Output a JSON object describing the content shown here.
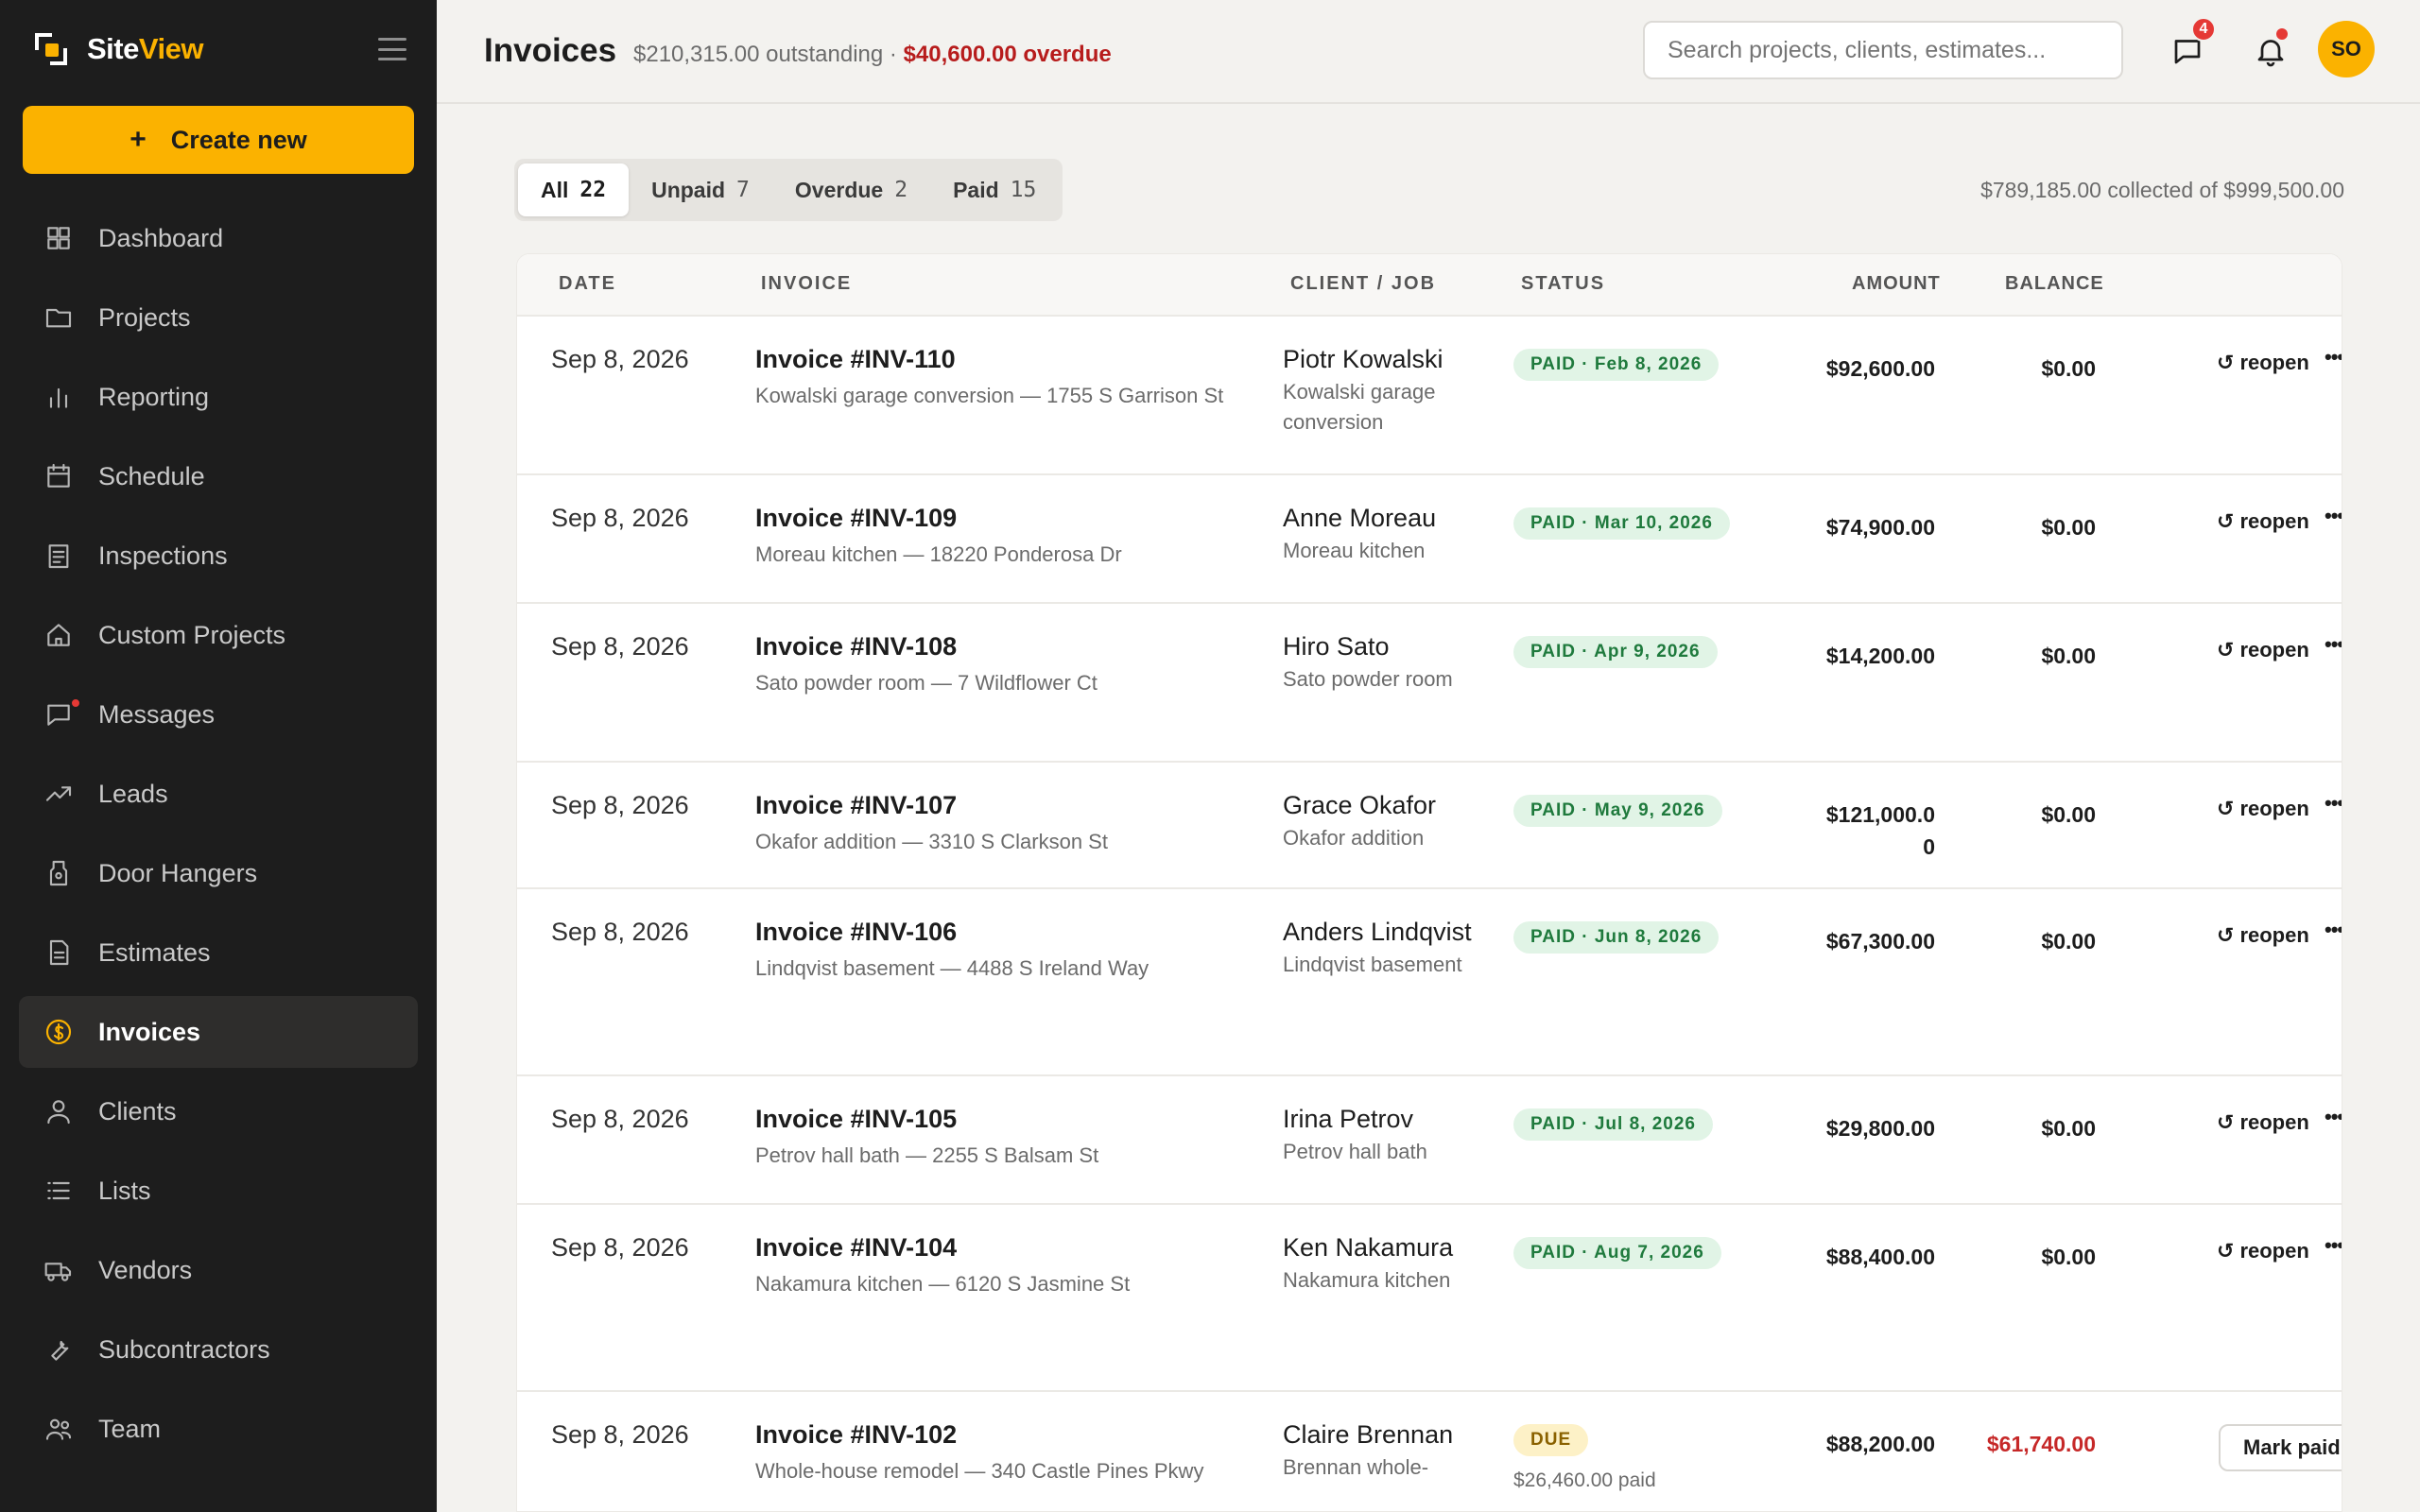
{
  "brand": {
    "name_part1": "Site",
    "name_part2": "View"
  },
  "create_button": {
    "plus": "+",
    "label": "Create new"
  },
  "nav": [
    {
      "label": "Dashboard",
      "icon": "dashboard-icon",
      "active": false
    },
    {
      "label": "Projects",
      "icon": "folder-icon",
      "active": false
    },
    {
      "label": "Reporting",
      "icon": "bar-chart-icon",
      "active": false
    },
    {
      "label": "Schedule",
      "icon": "calendar-icon",
      "active": false
    },
    {
      "label": "Inspections",
      "icon": "clipboard-icon",
      "active": false
    },
    {
      "label": "Custom Projects",
      "icon": "home-icon",
      "active": false
    },
    {
      "label": "Messages",
      "icon": "message-icon",
      "active": false
    },
    {
      "label": "Leads",
      "icon": "trending-up-icon",
      "active": false
    },
    {
      "label": "Door Hangers",
      "icon": "tag-icon",
      "active": false
    },
    {
      "label": "Estimates",
      "icon": "document-icon",
      "active": false
    },
    {
      "label": "Invoices",
      "icon": "dollar-icon",
      "active": true
    },
    {
      "label": "Clients",
      "icon": "user-icon",
      "active": false
    },
    {
      "label": "Lists",
      "icon": "list-icon",
      "active": false
    },
    {
      "label": "Vendors",
      "icon": "truck-icon",
      "active": false
    },
    {
      "label": "Subcontractors",
      "icon": "wrench-icon",
      "active": false
    },
    {
      "label": "Team",
      "icon": "team-icon",
      "active": false
    }
  ],
  "header": {
    "title": "Invoices",
    "outstanding": "$210,315.00 outstanding · ",
    "overdue": "$40,600.00 overdue",
    "search_placeholder": "Search projects, clients, estimates...",
    "messages_badge": "4",
    "avatar_initials": "SO"
  },
  "tabs": [
    {
      "label": "All",
      "count": "22",
      "active": true
    },
    {
      "label": "Unpaid",
      "count": "7",
      "active": false
    },
    {
      "label": "Overdue",
      "count": "2",
      "active": false
    },
    {
      "label": "Paid",
      "count": "15",
      "active": false
    }
  ],
  "collected": "$789,185.00 collected of $999,500.00",
  "table": {
    "columns": {
      "date": "DATE",
      "invoice": "INVOICE",
      "client": "CLIENT / JOB",
      "status": "STATUS",
      "amount": "AMOUNT",
      "balance": "BALANCE"
    },
    "rows": [
      {
        "date": "Sep 8, 2026",
        "title": "Invoice #INV-110",
        "sub": "Kowalski garage conversion — 1755 S Garrison St",
        "client": "Piotr Kowalski",
        "job": "Kowalski garage conversion",
        "status": "PAID · Feb 8, 2026",
        "status_type": "paid",
        "paid_note": "",
        "amount": "$92,600.00",
        "balance": "$0.00",
        "action": "reopen"
      },
      {
        "date": "Sep 8, 2026",
        "title": "Invoice #INV-109",
        "sub": "Moreau kitchen — 18220 Ponderosa Dr",
        "client": "Anne Moreau",
        "job": "Moreau kitchen",
        "status": "PAID · Mar 10, 2026",
        "status_type": "paid",
        "paid_note": "",
        "amount": "$74,900.00",
        "balance": "$0.00",
        "action": "reopen"
      },
      {
        "date": "Sep 8, 2026",
        "title": "Invoice #INV-108",
        "sub": "Sato powder room — 7 Wildflower Ct",
        "client": "Hiro Sato",
        "job": "Sato powder room",
        "status": "PAID · Apr 9, 2026",
        "status_type": "paid",
        "paid_note": "",
        "amount": "$14,200.00",
        "balance": "$0.00",
        "action": "reopen"
      },
      {
        "date": "Sep 8, 2026",
        "title": "Invoice #INV-107",
        "sub": "Okafor addition — 3310 S Clarkson St",
        "client": "Grace Okafor",
        "job": "Okafor addition",
        "status": "PAID · May 9, 2026",
        "status_type": "paid",
        "paid_note": "",
        "amount": "$121,000.00",
        "balance": "$0.00",
        "action": "reopen"
      },
      {
        "date": "Sep 8, 2026",
        "title": "Invoice #INV-106",
        "sub": "Lindqvist basement — 4488 S Ireland Way",
        "client": "Anders Lindqvist",
        "job": "Lindqvist basement",
        "status": "PAID · Jun 8, 2026",
        "status_type": "paid",
        "paid_note": "",
        "amount": "$67,300.00",
        "balance": "$0.00",
        "action": "reopen"
      },
      {
        "date": "Sep 8, 2026",
        "title": "Invoice #INV-105",
        "sub": "Petrov hall bath — 2255 S Balsam St",
        "client": "Irina Petrov",
        "job": "Petrov hall bath",
        "status": "PAID · Jul 8, 2026",
        "status_type": "paid",
        "paid_note": "",
        "amount": "$29,800.00",
        "balance": "$0.00",
        "action": "reopen"
      },
      {
        "date": "Sep 8, 2026",
        "title": "Invoice #INV-104",
        "sub": "Nakamura kitchen — 6120 S Jasmine St",
        "client": "Ken Nakamura",
        "job": "Nakamura kitchen",
        "status": "PAID · Aug 7, 2026",
        "status_type": "paid",
        "paid_note": "",
        "amount": "$88,400.00",
        "balance": "$0.00",
        "action": "reopen"
      },
      {
        "date": "Sep 8, 2026",
        "title": "Invoice #INV-102",
        "sub": "Whole-house remodel — 340 Castle Pines Pkwy",
        "client": "Claire Brennan",
        "job": "Brennan whole-",
        "status": "DUE",
        "status_type": "due",
        "paid_note": "$26,460.00 paid",
        "amount": "$88,200.00",
        "balance": "$61,740.00",
        "action": "Mark paid"
      }
    ]
  },
  "more_glyph": "•••",
  "reopen_glyph": "↺",
  "colors": {
    "accent": "#fbb200",
    "sidebar": "#1d1d1d",
    "overdue": "#b71c1c",
    "paid_bg": "#e1f4e6",
    "paid_fg": "#1f7a3d"
  }
}
